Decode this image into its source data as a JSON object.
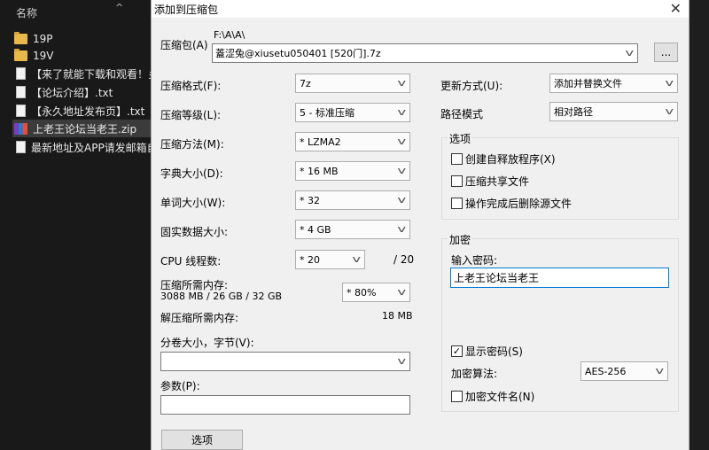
{
  "explorer": {
    "column_header": "名称",
    "items": [
      {
        "name": "19P",
        "icon": "folder-icon"
      },
      {
        "name": "19V",
        "icon": "folder-icon"
      },
      {
        "name": "【来了就能下载和观看！乡",
        "icon": "text-file-icon"
      },
      {
        "name": "【论坛介绍】.txt",
        "icon": "text-file-icon"
      },
      {
        "name": "【永久地址发布页】.txt",
        "icon": "text-file-icon"
      },
      {
        "name": "上老王论坛当老王.zip",
        "icon": "archive-icon"
      },
      {
        "name": "最新地址及APP请发邮箱自",
        "icon": "text-file-icon"
      }
    ]
  },
  "dialog": {
    "title": "添加到压缩包",
    "close_glyph": "✕",
    "archive_label": "压缩包(A)",
    "archive_path": "F:\\A\\A\\",
    "archive_name": "蓋涩兔@xiusetu050401 [520门].7z",
    "browse_label": "...",
    "format_label": "压缩格式(F):",
    "format_value": "7z",
    "level_label": "压缩等级(L):",
    "level_value": "5 - 标准压缩",
    "method_label": "压缩方法(M):",
    "method_value": "* LZMA2",
    "dict_label": "字典大小(D):",
    "dict_value": "* 16 MB",
    "word_label": "单词大小(W):",
    "word_value": "* 32",
    "solid_label": "固实数据大小:",
    "solid_value": "* 4 GB",
    "cpu_label": "CPU 线程数:",
    "cpu_value": "* 20",
    "cpu_max": "/ 20",
    "mem_label": "压缩所需内存:",
    "mem_detail": "3088 MB / 26 GB / 32 GB",
    "mem_percent": "* 80%",
    "decomp_label": "解压缩所需内存:",
    "decomp_value": "18 MB",
    "split_label": "分卷大小，字节(V):",
    "split_value": "",
    "params_label": "参数(P):",
    "params_value": "",
    "options_button": "选项",
    "update_label": "更新方式(U):",
    "update_value": "添加并替换文件",
    "pathmode_label": "路径模式",
    "pathmode_value": "相对路径",
    "options_group_title": "选项",
    "opt_sfx": "创建自释放程序(X)",
    "opt_shared": "压缩共享文件",
    "opt_delete": "操作完成后删除源文件",
    "encrypt_group_title": "加密",
    "password_label": "输入密码:",
    "password_value": "上老王论坛当老王",
    "show_password": "显示密码(S)",
    "enc_method_label": "加密算法:",
    "enc_method_value": "AES-256",
    "encrypt_names": "加密文件名(N)",
    "check_mark": "✓"
  },
  "colors": {
    "accent": "#0078d7",
    "explorer_bg": "#191919",
    "dialog_bg": "#f0f0f0"
  }
}
